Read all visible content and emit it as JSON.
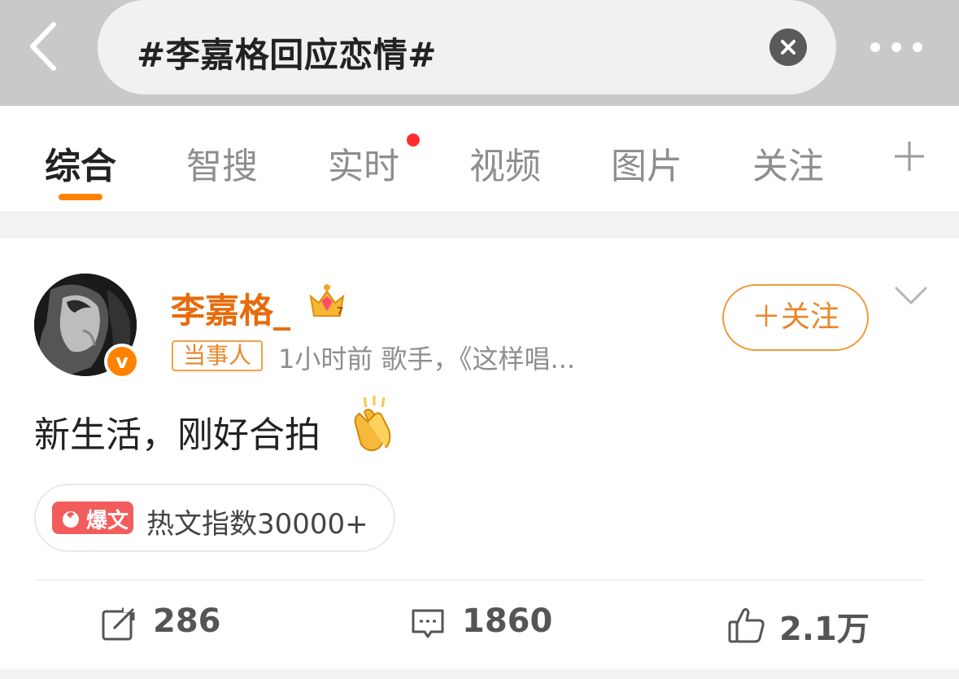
{
  "header": {
    "search_query": "#李嘉格回应恋情#",
    "back_icon": "chevron-left-icon",
    "clear_icon": "close-circle-icon",
    "more_icon": "more-dots-icon"
  },
  "tabs": [
    {
      "label": "综合",
      "active": true
    },
    {
      "label": "智搜",
      "active": false
    },
    {
      "label": "实时",
      "active": false,
      "badge": "red-dot"
    },
    {
      "label": "视频",
      "active": false
    },
    {
      "label": "图片",
      "active": false
    },
    {
      "label": "关注",
      "active": false
    }
  ],
  "accent_color": "#ff8200",
  "post": {
    "username": "李嘉格_",
    "party_badge": "当事人",
    "meta": "1小时前  歌手，《这样唱...",
    "follow_label": "＋关注",
    "text": "新生活，刚好合拍",
    "hot_tag": "爆文",
    "hot_text": "热文指数30000+",
    "actions": {
      "repost": "286",
      "comments": "1860",
      "likes": "2.1万"
    }
  }
}
